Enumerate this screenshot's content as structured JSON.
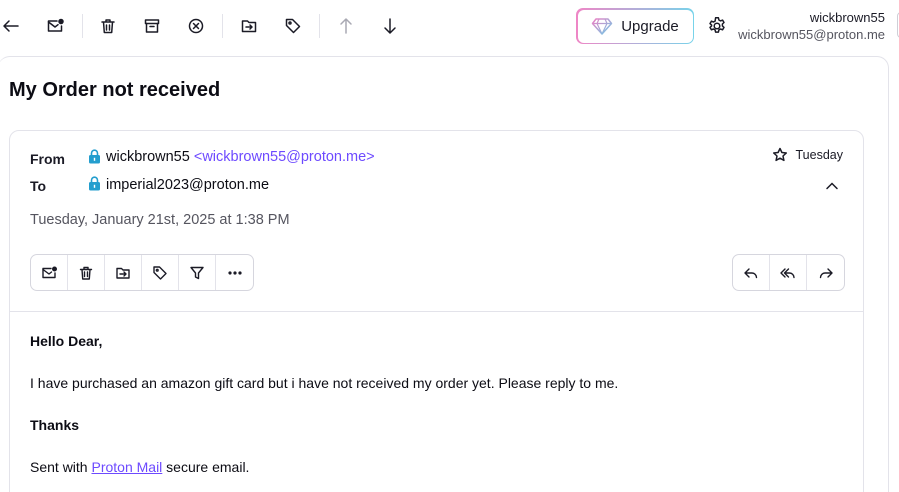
{
  "toolbar": {
    "buttons": [
      {
        "name": "back",
        "icon": "arrow-left-icon"
      },
      {
        "name": "mark-unread",
        "icon": "envelope-dot-icon"
      },
      {
        "name": "trash",
        "icon": "trash-icon"
      },
      {
        "name": "archive",
        "icon": "archive-icon"
      },
      {
        "name": "spam",
        "icon": "circle-x-icon"
      },
      {
        "name": "move",
        "icon": "folder-arrow-icon"
      },
      {
        "name": "label",
        "icon": "tag-icon"
      },
      {
        "name": "previous",
        "icon": "arrow-up-icon",
        "disabled": true
      },
      {
        "name": "next",
        "icon": "arrow-down-icon"
      }
    ],
    "upgrade_label": "Upgrade",
    "settings_icon": "gear-icon"
  },
  "user": {
    "name": "wickbrown55",
    "email": "wickbrown55@proton.me"
  },
  "message": {
    "subject": "My Order not received",
    "from_label": "From",
    "to_label": "To",
    "from_name": "wickbrown55",
    "from_email": "<wickbrown55@proton.me>",
    "to_address": "imperial2023@proton.me",
    "short_date": "Tuesday",
    "full_date": "Tuesday, January 21st, 2025 at 1:38 PM",
    "body": {
      "greeting": "Hello Dear,",
      "paragraph": "I have purchased an amazon gift card but i have not received my order yet. Please reply to me.",
      "closing": "Thanks",
      "signature_prefix": "Sent with ",
      "signature_link": "Proton Mail",
      "signature_suffix": " secure email."
    }
  },
  "colors": {
    "accent": "#6d4aff",
    "lock": "#239ece",
    "border": "#e3e3ea"
  }
}
